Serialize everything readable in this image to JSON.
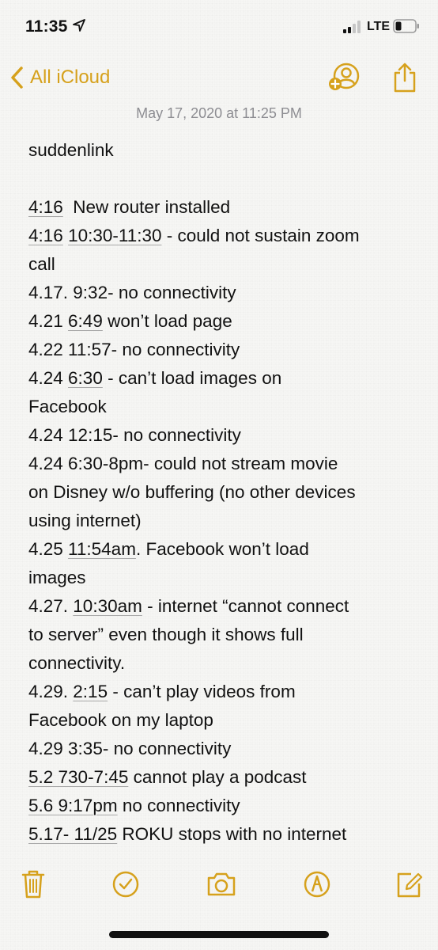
{
  "status_bar": {
    "time": "11:35",
    "network": "LTE",
    "icons": [
      "location-arrow-icon",
      "signal-bars-icon",
      "battery-icon"
    ]
  },
  "nav": {
    "back_label": "All iCloud",
    "icons": [
      "chevron-left-icon",
      "add-person-icon",
      "share-icon"
    ]
  },
  "accent_color": "#d6a11c",
  "note": {
    "date": "May 17, 2020 at 11:25 PM",
    "lines": [
      [
        {
          "t": "suddenlink"
        }
      ],
      [],
      [
        {
          "t": "4:16",
          "u": true
        },
        {
          "t": "  New router installed"
        }
      ],
      [
        {
          "t": "4:16",
          "u": true
        },
        {
          "t": " "
        },
        {
          "t": "10:30-11:30",
          "u": true
        },
        {
          "t": " - could not sustain zoom"
        }
      ],
      [
        {
          "t": "call"
        }
      ],
      [
        {
          "t": "4.17. 9:32- no connectivity"
        }
      ],
      [
        {
          "t": "4.21 "
        },
        {
          "t": "6:49",
          "u": true
        },
        {
          "t": " won’t load page"
        }
      ],
      [
        {
          "t": "4.22 11:57- no connectivity"
        }
      ],
      [
        {
          "t": "4.24 "
        },
        {
          "t": "6:30",
          "u": true
        },
        {
          "t": " - can’t load images on"
        }
      ],
      [
        {
          "t": "Facebook"
        }
      ],
      [
        {
          "t": "4.24 12:15- no connectivity"
        }
      ],
      [
        {
          "t": "4.24 6:30-8pm- could not stream movie"
        }
      ],
      [
        {
          "t": "on Disney w/o buffering (no other devices"
        }
      ],
      [
        {
          "t": "using internet)"
        }
      ],
      [
        {
          "t": "4.25 "
        },
        {
          "t": "11:54am",
          "u": true
        },
        {
          "t": ". Facebook won’t load"
        }
      ],
      [
        {
          "t": "images"
        }
      ],
      [
        {
          "t": "4.27. "
        },
        {
          "t": "10:30am",
          "u": true
        },
        {
          "t": " - internet “cannot connect"
        }
      ],
      [
        {
          "t": "to server” even though it shows full"
        }
      ],
      [
        {
          "t": "connectivity."
        }
      ],
      [
        {
          "t": "4.29. "
        },
        {
          "t": "2:15",
          "u": true
        },
        {
          "t": " - can’t play videos from"
        }
      ],
      [
        {
          "t": "Facebook on my laptop"
        }
      ],
      [
        {
          "t": "4.29 3:35- no connectivity"
        }
      ],
      [
        {
          "t": "5.2 730-7:45",
          "u": true
        },
        {
          "t": " cannot play a podcast"
        }
      ],
      [
        {
          "t": "5.6 9:17pm",
          "u": true
        },
        {
          "t": " no connectivity"
        }
      ],
      [
        {
          "t": "5.17- 11/25",
          "u": true
        },
        {
          "t": " ROKU stops with no internet"
        }
      ]
    ]
  },
  "toolbar": {
    "icons": [
      "trash-icon",
      "checklist-icon",
      "camera-icon",
      "markup-icon",
      "compose-icon"
    ]
  }
}
